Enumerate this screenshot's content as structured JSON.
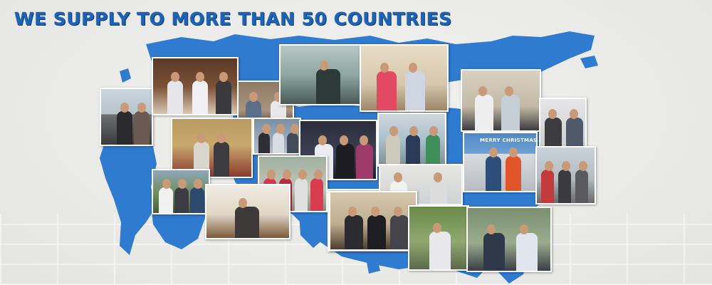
{
  "headline": "WE SUPPLY TO MORE THAN 50 COUNTRIES",
  "colors": {
    "accent": "#1c63b5",
    "map": "#2f7bd0",
    "background": "#eeeeec"
  },
  "icons": [
    "world-map-graphic"
  ],
  "photos": [
    {
      "name": "photo-two-men-at-airport"
    },
    {
      "name": "photo-group-restaurant-toast"
    },
    {
      "name": "photo-men-reviewing-samples"
    },
    {
      "name": "photo-man-sunglasses-signage"
    },
    {
      "name": "photo-two-men-sofa"
    },
    {
      "name": "photo-two-men-office-table"
    },
    {
      "name": "photo-woman-and-man-selfie"
    },
    {
      "name": "photo-men-hotel-lobby"
    },
    {
      "name": "photo-group-of-four-men"
    },
    {
      "name": "photo-couple-at-event"
    },
    {
      "name": "photo-group-in-front-of-logo-wall"
    },
    {
      "name": "photo-group-sports-jerseys"
    },
    {
      "name": "photo-three-people-outdoors"
    },
    {
      "name": "photo-man-seated-desk"
    },
    {
      "name": "photo-men-in-meeting-room"
    },
    {
      "name": "photo-two-men-in-office"
    },
    {
      "name": "photo-christmas-banner-office"
    },
    {
      "name": "photo-group-outdoor-construction"
    },
    {
      "name": "photo-three-men-dinner-table"
    },
    {
      "name": "photo-man-with-backpack"
    },
    {
      "name": "photo-two-men-selfie-outdoors"
    }
  ],
  "banner_text": "MERRY CHRISTMAS"
}
